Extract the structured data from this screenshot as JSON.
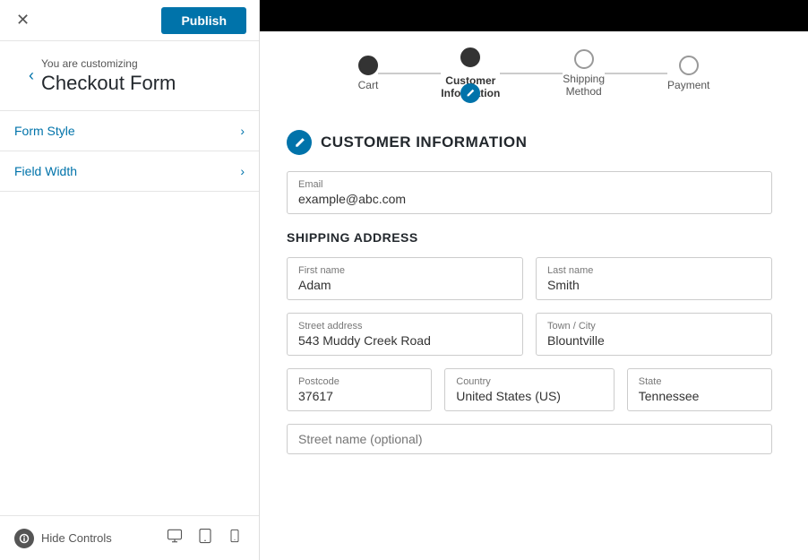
{
  "header": {
    "close_label": "✕",
    "publish_label": "Publish",
    "you_are_label": "You are customizing",
    "title": "Checkout Form",
    "back_icon": "‹"
  },
  "sidebar": {
    "menu_items": [
      {
        "id": "form-style",
        "label": "Form Style"
      },
      {
        "id": "field-width",
        "label": "Field Width"
      }
    ],
    "hide_controls_label": "Hide Controls"
  },
  "steps": [
    {
      "id": "cart",
      "label": "Cart",
      "state": "filled"
    },
    {
      "id": "customer",
      "label": "Customer\nInformation",
      "state": "active",
      "has_edit": true
    },
    {
      "id": "shipping",
      "label": "Shipping\nMethod",
      "state": "empty"
    },
    {
      "id": "payment",
      "label": "Payment",
      "state": "empty"
    }
  ],
  "customer_info": {
    "section_title": "CUSTOMER INFORMATION",
    "email_label": "Email",
    "email_value": "example@abc.com",
    "shipping_address_title": "SHIPPING ADDRESS",
    "first_name_label": "First name",
    "first_name_value": "Adam",
    "last_name_label": "Last name",
    "last_name_value": "Smith",
    "street_label": "Street address",
    "street_value": "543 Muddy Creek Road",
    "town_label": "Town / City",
    "town_value": "Blountville",
    "postcode_label": "Postcode",
    "postcode_value": "37617",
    "country_label": "Country",
    "country_value": "United States (US)",
    "state_label": "State",
    "state_value": "Tennessee",
    "street2_label": "Street name (optional)",
    "street2_value": ""
  },
  "colors": {
    "blue": "#0073aa",
    "dark": "#23282d",
    "border": "#ccc"
  }
}
